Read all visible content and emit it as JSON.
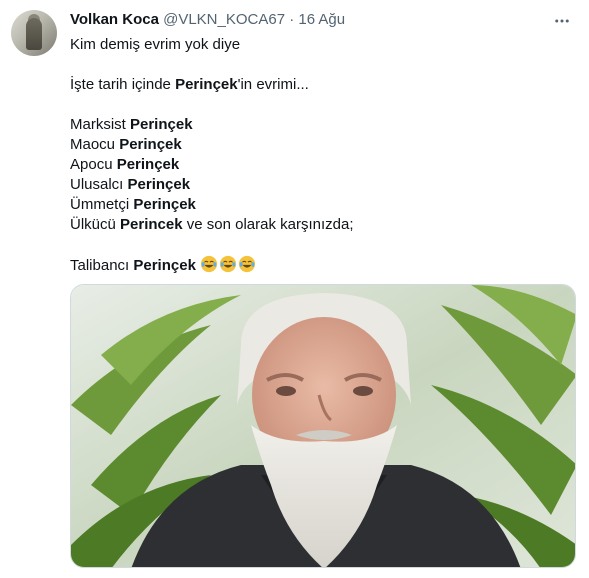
{
  "tweet": {
    "author_name": "Volkan Koca",
    "handle": "@VLKN_KOCA67",
    "separator": "·",
    "date": "16 Ağu",
    "lines": {
      "l1": "Kim demiş evrim yok diye",
      "l2_pre": "İşte tarih içinde ",
      "l2_bold": "Perinçek",
      "l2_post": "'in evrimi...",
      "l3_pre": "Marksist ",
      "l3_bold": "Perinçek",
      "l4_pre": "Maocu ",
      "l4_bold": "Perinçek",
      "l5_pre": "Apocu ",
      "l5_bold": "Perinçek",
      "l6_pre": "Ulusalcı ",
      "l6_bold": "Perinçek",
      "l7_pre": "Ümmetçi ",
      "l7_bold": "Perinçek",
      "l8_pre": "Ülkücü ",
      "l8_bold": "Perincek",
      "l8_post": " ve son olarak karşınızda;",
      "l9_pre": "Talibancı ",
      "l9_bold": "Perinçek"
    },
    "emoji_names": [
      "face-with-tears-of-joy-icon",
      "face-with-tears-of-joy-icon",
      "face-with-tears-of-joy-icon"
    ]
  },
  "colors": {
    "text": "#0f1419",
    "secondary": "#536471",
    "border": "#cfd9de",
    "emoji": "#f5c33b"
  },
  "icons": {
    "more": "more-options-icon"
  }
}
